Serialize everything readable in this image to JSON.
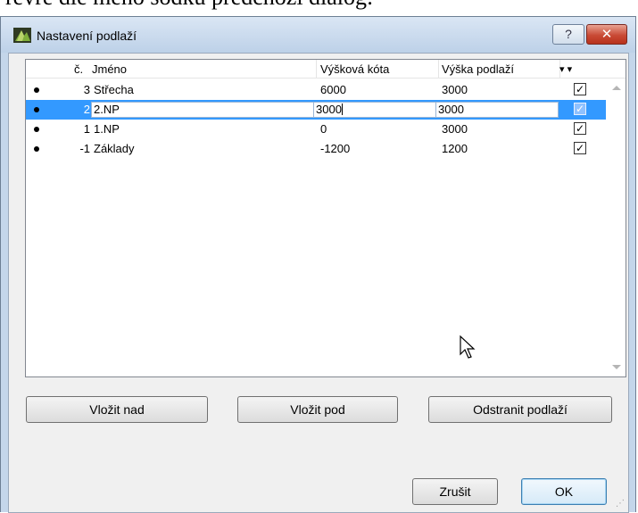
{
  "background_text": "řevře dle měno sodku předchozí dialog:",
  "window": {
    "title": "Nastavení podlaží",
    "help_label": "?",
    "close_label": "✕"
  },
  "table": {
    "headers": {
      "num": "č.",
      "name": "Jméno",
      "elevation": "Výšková kóta",
      "height": "Výška podlaží",
      "show": "▾ ▾"
    },
    "rows": [
      {
        "num": "3",
        "name": "Střecha",
        "elevation": "6000",
        "height": "3000",
        "checked": true,
        "selected": false
      },
      {
        "num": "2",
        "name": "2.NP",
        "elevation": "3000",
        "height": "3000",
        "checked": true,
        "selected": true
      },
      {
        "num": "1",
        "name": "1.NP",
        "elevation": "0",
        "height": "3000",
        "checked": true,
        "selected": false
      },
      {
        "num": "-1",
        "name": "Základy",
        "elevation": "-1200",
        "height": "1200",
        "checked": true,
        "selected": false
      }
    ]
  },
  "buttons": {
    "insert_above": "Vložit nad",
    "insert_below": "Vložit pod",
    "remove_story": "Odstranit podlaží",
    "cancel": "Zrušit",
    "ok": "OK"
  },
  "colors": {
    "selection": "#3399ff",
    "frame": "#c4d6ea",
    "close": "#c94a35"
  }
}
